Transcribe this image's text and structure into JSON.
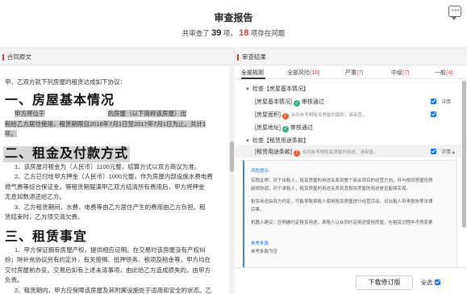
{
  "header": {
    "title": "审查报告",
    "summary_pre": "共审查了",
    "total": "39",
    "summary_mid": "项，",
    "issues": "18",
    "summary_post": "项存在问题",
    "chat_glyph": "•••"
  },
  "left_panel": {
    "title": "合同原文",
    "intro": "甲、乙双方就下列房屋的租赁达成如下协议：",
    "h1": "一、房屋基本情况",
    "p1a": "甲方将位于",
    "p1b": "的房屋（以下简称该房屋）出",
    "p1c": "租给乙方居住使用，租赁期限自2016年7月1日至2017年7月1日为止。共计1",
    "p1d": "年。",
    "h2": "二、租金及付款方式",
    "p2a": "1、该房屋月租金为（人民币）1100元整，结算方式以双方商议为准。",
    "p2b": "2、乙方已付给甲方押金（人民币）1000元整，作为房屋内部设施水费电费",
    "p2c": "燃气费等综合保证金。等租赁期届满甲乙双方结清所有费用后，甲方将押金",
    "p2d": "无息如数退还给乙方。",
    "p2e": "3、乙方租赁期间，水费、电费等由乙方居住产生的费用由乙方负担。租",
    "p2f": "赁结束时，乙方须交清欠费。",
    "h3": "三、租赁事宜",
    "p3a": "1、甲方保证拥有房屋产权，提供相应证明。在交易时该房屋没有产权纠",
    "p3b": "纷；除补充协议另有约定外，有关按揭、抵押债务、税项及租金等，甲方均在",
    "p3c": "交付房屋前办妥。交易后如有上述未清事项，由此给乙方造成损失的，由甲方",
    "p3d": "负责。",
    "p3e": "2、租赁期内，甲方应保障该房屋及其附属设施处于适用和安全的状态。乙"
  },
  "right_panel": {
    "title": "审查结果",
    "tabs": [
      {
        "label": "全部规则",
        "count": ""
      },
      {
        "label": "全部风险",
        "count": "(18)"
      },
      {
        "label": "严重",
        "count": "(7)"
      },
      {
        "label": "中级",
        "count": "(7)"
      },
      {
        "label": "一般",
        "count": "(4)"
      }
    ],
    "group1": "检查【房屋基本情况】",
    "rows": [
      {
        "label": "[房屋基本情况]",
        "status": "审核通过",
        "msg": "",
        "detail": "详情"
      },
      {
        "label": "[房屋面积]",
        "status": "",
        "msg": "合同未写明租赁房屋的面积，请审查。",
        "detail": ""
      },
      {
        "label": "[房屋地址]",
        "status": "审核通过",
        "msg": "",
        "detail": ""
      }
    ],
    "group2": "检查【租赁用途条款】",
    "row4": {
      "label": "[租赁用途条款]",
      "msg": "合同未写明租赁房屋的用途，请审查。",
      "detail": "详情"
    },
    "expand": {
      "risk_title": "风险提示",
      "risk1": "实践证明：对于出租人，租赁房屋的用途关系到整个商业项目的经营方向，并与相邻房屋性质",
      "risk1b": "能相协调；对于承租人，租赁房屋的用途关系到其租赁房屋的用途是否能够实现。",
      "risk2": "租赁用途由双方约定，可能导致承租人使用租赁房屋进行经营活动，对出租人带来损失等法律",
      "risk2b": "后果。",
      "risk3": "机器人建议：应明确约定租赁用途，承租人以合同约定用途使用房屋，在租赁过程中不得变更",
      "ref_title": "参考条款",
      "ref_body": "参考条款为空"
    },
    "footer": {
      "select_all": "全选",
      "download": "下载修订版"
    }
  }
}
